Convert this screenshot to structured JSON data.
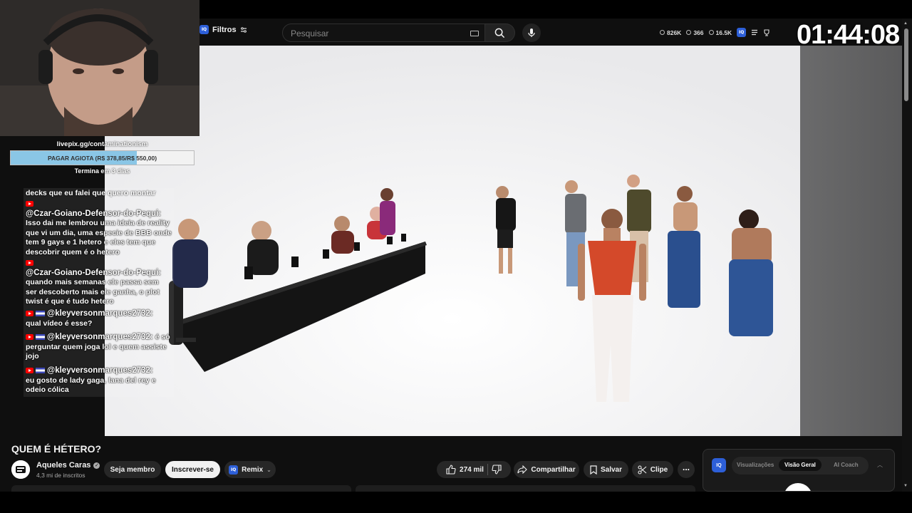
{
  "header": {
    "filters_label": "Filtros",
    "iq_label": "IQ",
    "search_placeholder": "Pesquisar",
    "stats": {
      "views": "826K",
      "watching": "366",
      "other": "16.5K"
    }
  },
  "timer": "01:44:08",
  "donation": {
    "url": "livepix.gg/contaminationism",
    "goal_text": "PAGAR AGIOTA (R$ 378,85/R$ 550,00)",
    "progress_fraction": 0.6888,
    "ends": "Termina em 3 dias"
  },
  "chat": {
    "cut_line": "decks que eu falei que quero montar",
    "messages": [
      {
        "user": "@Czar-Goiano-Defensor-do-Pequi:",
        "text": "Isso dai me lembrou uma ideia de reality que vi um dia, uma especie de BBB onde tem 9 gays e 1 hetero e eles tem que descobrir quem é o hetero",
        "flag": false
      },
      {
        "user": "@Czar-Goiano-Defensor-do-Pequi:",
        "text": "quando mais semanas ele passa sem ser descoberto mais ele ganha, o plot twist é que é tudo hetero",
        "flag": false
      },
      {
        "user": "@kleyversonmarques2732:",
        "text": "qual vídeo é esse?",
        "flag": true
      },
      {
        "user": "@kleyversonmarques2732:",
        "text": "é só perguntar quem joga lol e quem assiste jojo",
        "flag": true
      },
      {
        "user": "@kleyversonmarques2732:",
        "text": "eu gosto de lady gaga, lana del rey e odeio cólica",
        "flag": true
      }
    ]
  },
  "video": {
    "title": "QUEM É HÉTERO?",
    "channel_name": "Aqueles Caras",
    "subscribers": "4,3 mi de inscritos",
    "join_label": "Seja membro",
    "subscribe_label": "Inscrever-se",
    "remix_label": "Remix",
    "likes": "274 mil",
    "share_label": "Compartilhar",
    "save_label": "Salvar",
    "clip_label": "Clipe",
    "more_label": "..."
  },
  "panel": {
    "iq_label": "IQ",
    "tabs": [
      "Visualizações",
      "Visão Geral",
      "AI Coach"
    ],
    "active_tab": "Visão Geral"
  },
  "colors": {
    "accent_blue": "#2d5fd8",
    "youtube_red": "#ff0000",
    "donate_fill": "#8ac6e6"
  }
}
